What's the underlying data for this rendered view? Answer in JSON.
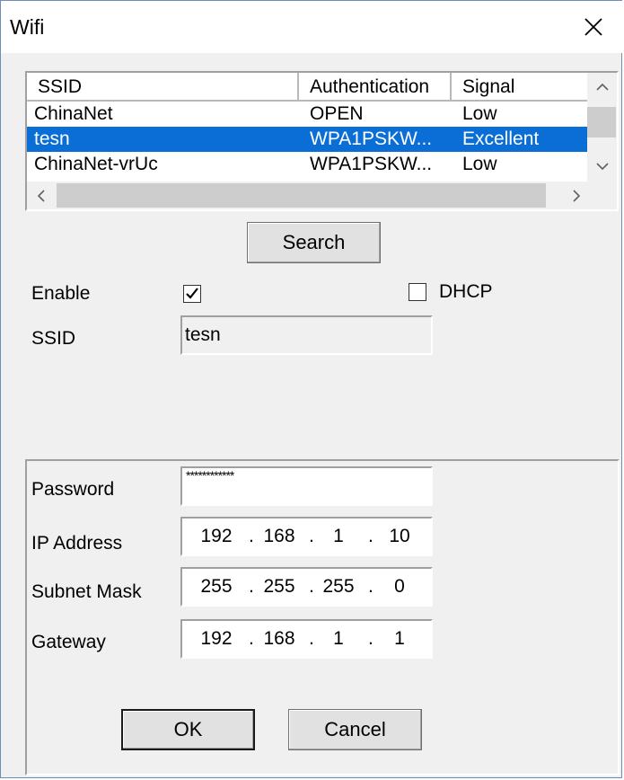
{
  "window": {
    "title": "Wifi"
  },
  "network_list": {
    "columns": [
      "SSID",
      "Authentication",
      "Signal"
    ],
    "rows": [
      {
        "ssid": "ChinaNet",
        "auth": "OPEN",
        "signal": "Low",
        "selected": false
      },
      {
        "ssid": "tesn",
        "auth": "WPA1PSKW...",
        "signal": "Excellent",
        "selected": true
      },
      {
        "ssid": "ChinaNet-vrUc",
        "auth": "WPA1PSKW...",
        "signal": "Low",
        "selected": false
      }
    ]
  },
  "buttons": {
    "search": "Search",
    "ok": "OK",
    "cancel": "Cancel"
  },
  "form": {
    "enable_label": "Enable",
    "enable_checked": true,
    "dhcp_label": "DHCP",
    "dhcp_checked": false,
    "ssid_label": "SSID",
    "ssid_value": "tesn",
    "password_label": "Password",
    "password_value": "************",
    "ip_label": "IP Address",
    "ip_octets": [
      "192",
      "168",
      "1",
      "10"
    ],
    "subnet_label": "Subnet Mask",
    "subnet_octets": [
      "255",
      "255",
      "255",
      "0"
    ],
    "gateway_label": "Gateway",
    "gateway_octets": [
      "192",
      "168",
      "1",
      "1"
    ]
  },
  "colors": {
    "selection": "#0a6ed6",
    "face": "#f0f0f0"
  }
}
